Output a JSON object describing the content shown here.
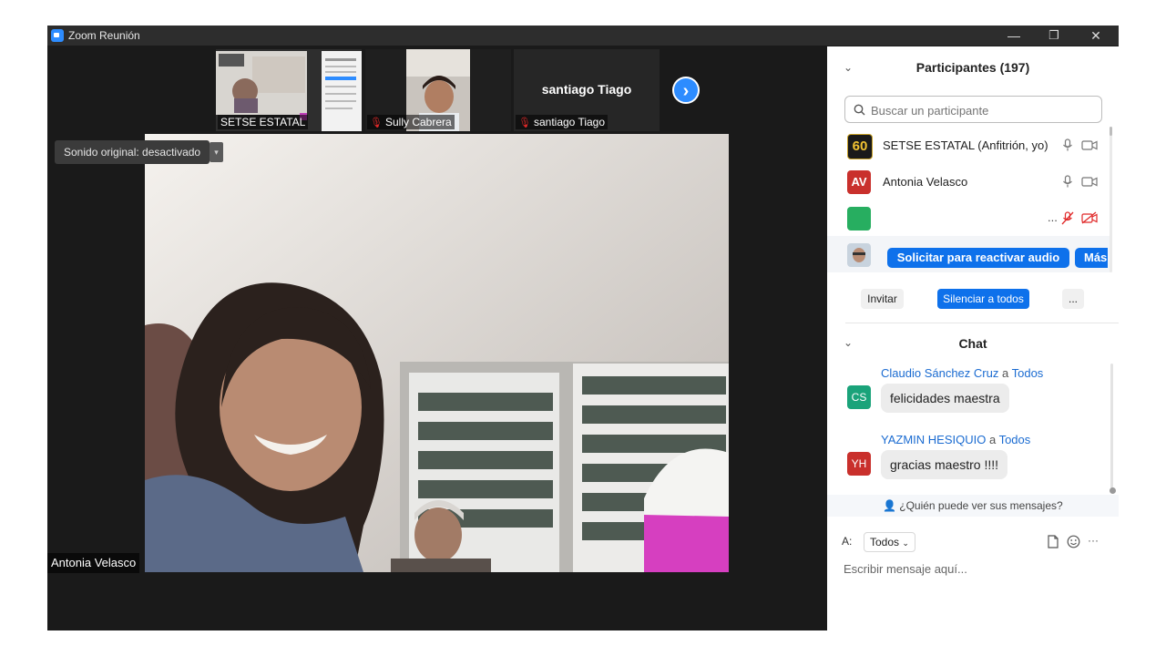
{
  "window": {
    "title": "Zoom Reunión",
    "minimize_glyph": "—",
    "restore_glyph": "❐",
    "close_glyph": "✕"
  },
  "thumbnails": [
    {
      "name": "SETSE ESTATAL",
      "muted": false
    },
    {
      "name": "Sully Cabrera",
      "muted": true
    },
    {
      "name": "santiago Tiago",
      "muted": true,
      "title_text": "santiago Tiago"
    }
  ],
  "next_thumbs_glyph": "›",
  "sound": {
    "label": "Sonido original: desactivado",
    "caret": "▾"
  },
  "main_video": {
    "speaker_name": "Antonia Velasco"
  },
  "participants": {
    "header": "Participantes (197)",
    "search_placeholder": "Buscar un participante",
    "rows": [
      {
        "avatar_text": "60",
        "avatar_color": "#1a1a1a",
        "name": "SETSE ESTATAL (Anfitrión, yo)",
        "audio": "mic-icon",
        "video": "camera-icon"
      },
      {
        "avatar_text": "AV",
        "avatar_color": "#c9302c",
        "name": "Antonia Velasco",
        "audio": "mic-icon",
        "video": "camera-icon"
      },
      {
        "avatar_text": "",
        "avatar_color": "#27ae60",
        "name": "",
        "dots": "...",
        "audio": "mic-muted-icon",
        "video": "camera-off-icon"
      },
      {
        "avatar_text": "",
        "avatar_color": "#8aa0b5",
        "name": ""
      }
    ],
    "reactivar_label": "Solicitar para reactivar audio",
    "mas_label": "Más",
    "invitar_label": "Invitar",
    "silenciar_label": "Silenciar a todos",
    "more_label": "..."
  },
  "chat": {
    "header": "Chat",
    "messages": [
      {
        "avatar": "CS",
        "avatar_color": "#1aa37a",
        "sender": "Claudio Sánchez Cruz",
        "connector": "a",
        "recipient": "Todos",
        "text": "felicidades maestra"
      },
      {
        "avatar": "YH",
        "avatar_color": "#c9302c",
        "sender": "YAZMIN HESIQUIO",
        "connector": "a",
        "recipient": "Todos",
        "text": "gracias maestro !!!!"
      }
    ],
    "who_sees": "¿Quién puede ver sus mensajes?",
    "to_label": "A:",
    "to_value": "Todos",
    "input_placeholder": "Escribir mensaje aquí...",
    "more_glyph": "···"
  }
}
